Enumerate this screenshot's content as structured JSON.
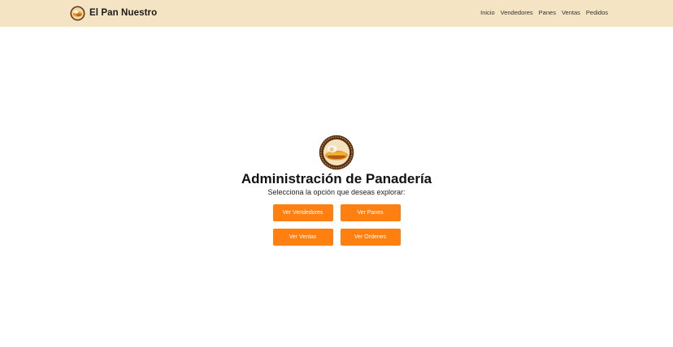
{
  "header": {
    "brand_name": "El Pan Nuestro",
    "logo_icon": "bakery-logo-icon",
    "nav": [
      {
        "label": "Inicio"
      },
      {
        "label": "Vendedores"
      },
      {
        "label": "Panes"
      },
      {
        "label": "Ventas"
      },
      {
        "label": "Pedidos"
      }
    ]
  },
  "main": {
    "logo_icon": "bakery-logo-icon",
    "title": "Administración de Panadería",
    "subtitle": "Selecciona la opción que deseas explorar:",
    "buttons": [
      {
        "label": "Ver Vendedores"
      },
      {
        "label": "Ver Panes"
      },
      {
        "label": "Ver Ventas"
      },
      {
        "label": "Ver Ordenes"
      }
    ]
  },
  "colors": {
    "header_bg": "#f5e4c3",
    "accent": "#ff7f11"
  }
}
